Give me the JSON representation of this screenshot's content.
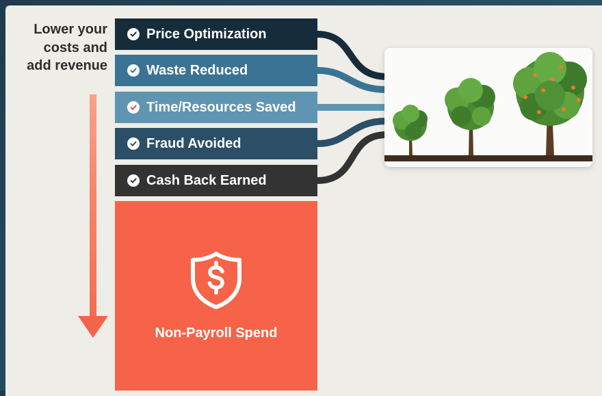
{
  "side_label": [
    "Lower your",
    "costs and",
    "add revenue"
  ],
  "benefits": [
    {
      "label": "Price Optimization",
      "color": "#162c3a",
      "check_color": "#162c3a"
    },
    {
      "label": "Waste Reduced",
      "color": "#3a7393",
      "check_color": "#3a7393"
    },
    {
      "label": "Time/Resources Saved",
      "color": "#5f95b3",
      "check_color": "#e4483a"
    },
    {
      "label": "Fraud Avoided",
      "color": "#2a4f66",
      "check_color": "#2a4f66"
    },
    {
      "label": "Cash Back Earned",
      "color": "#333333",
      "check_color": "#333333"
    }
  ],
  "spend": {
    "label": "Non-Payroll Spend",
    "color": "#f76348",
    "icon": "dollar-shield-icon"
  },
  "illustration": {
    "icon": "growing-trees-illustration"
  },
  "colors": {
    "background": "#eeede8",
    "arrow": "#f3654a"
  }
}
